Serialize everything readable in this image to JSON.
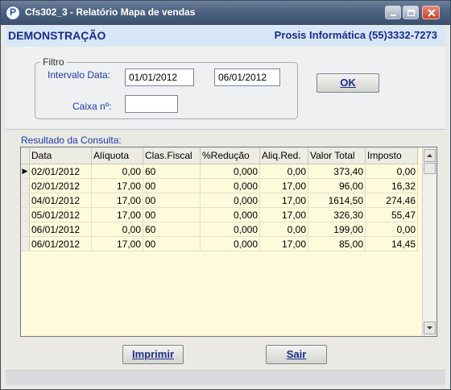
{
  "window": {
    "title": "Cfs302_3 - Relatório Mapa de vendas",
    "app_icon_letter": "P"
  },
  "header": {
    "left": "DEMONSTRAÇÃO",
    "right": "Prosis Informática (55)3332-7273"
  },
  "filtro": {
    "legend": "Filtro",
    "intervalo_label": "Intervalo Data:",
    "date_from": "01/01/2012",
    "date_to": "06/01/2012",
    "caixa_label": "Caixa nº:",
    "caixa_value": "",
    "ok_label": "OK"
  },
  "resultado": {
    "label": "Resultado da Consulta:",
    "columns": [
      "Data",
      "Alíquota",
      "Clas.Fiscal",
      "%Redução",
      "Aliq.Red.",
      "Valor Total",
      "Imposto"
    ],
    "rows": [
      {
        "data": "02/01/2012",
        "aliquota": "0,00",
        "clas": "60",
        "reducao": "0,000",
        "aliqred": "0,00",
        "total": "373,40",
        "imposto": "0,00"
      },
      {
        "data": "02/01/2012",
        "aliquota": "17,00",
        "clas": "00",
        "reducao": "0,000",
        "aliqred": "17,00",
        "total": "96,00",
        "imposto": "16,32"
      },
      {
        "data": "04/01/2012",
        "aliquota": "17,00",
        "clas": "00",
        "reducao": "0,000",
        "aliqred": "17,00",
        "total": "1614,50",
        "imposto": "274,46"
      },
      {
        "data": "05/01/2012",
        "aliquota": "17,00",
        "clas": "00",
        "reducao": "0,000",
        "aliqred": "17,00",
        "total": "326,30",
        "imposto": "55,47"
      },
      {
        "data": "06/01/2012",
        "aliquota": "0,00",
        "clas": "60",
        "reducao": "0,000",
        "aliqred": "0,00",
        "total": "199,00",
        "imposto": "0,00"
      },
      {
        "data": "06/01/2012",
        "aliquota": "17,00",
        "clas": "00",
        "reducao": "0,000",
        "aliqred": "17,00",
        "total": "85,00",
        "imposto": "14,45"
      }
    ],
    "current_row_indicator": "▶"
  },
  "buttons": {
    "imprimir": "Imprimir",
    "sair": "Sair"
  },
  "colors": {
    "title_bar": "#4d6280",
    "header_bg": "#d7e7f7",
    "header_text": "#1a2a8c",
    "grid_bg": "#fdfbdc",
    "label_blue": "#1b3ca8"
  }
}
